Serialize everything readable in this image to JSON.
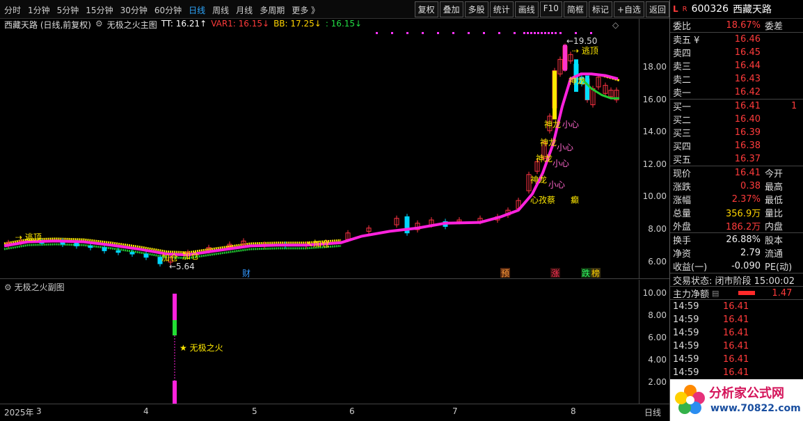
{
  "toolbar": {
    "periods": [
      "分时",
      "1分钟",
      "5分钟",
      "15分钟",
      "30分钟",
      "60分钟",
      "日线",
      "周线",
      "月线",
      "多周期",
      "更多 》"
    ],
    "active_period": "日线",
    "actions": [
      "复权",
      "叠加",
      "多股",
      "统计",
      "画线",
      "F10",
      "简框",
      "标记",
      "+自选",
      "返回"
    ]
  },
  "main_header": {
    "stock": "西藏天路 (日线,前复权)",
    "indicator": "无极之火主图",
    "tt": "TT: 16.21↑",
    "var1": "VAR1: 16.15↓",
    "bb": "BB: 17.25↓",
    "last": ": 16.15↓"
  },
  "chart_labels": {
    "escape_top_left": "逃顶",
    "escape_top_right": "逃顶",
    "jiacang_1": "加仓",
    "jiacang_2": "加仓",
    "jiacang_3": "加仓",
    "low_mark": "←5.64",
    "high_mark": "←19.50",
    "shenlong": "神龙",
    "xiaoxin": "小心",
    "zhiaoqi": "心孜蔡",
    "dian": "癫",
    "cai": "财",
    "yu": "预",
    "zhang": "涨",
    "die": "跌",
    "bang": "榜",
    "sub_title": "无极之火副图",
    "sub_legend": "★ 无极之火"
  },
  "main_axis": [
    "18.00",
    "16.00",
    "14.00",
    "12.00",
    "10.00",
    "8.00",
    "6.00"
  ],
  "sub_axis": [
    "10.00",
    "8.00",
    "6.00",
    "4.00",
    "2.00"
  ],
  "date_axis": [
    "2025年",
    "3",
    "4",
    "5",
    "6",
    "7",
    "8",
    "日线"
  ],
  "quote": {
    "code": "600326",
    "name": "西藏天路",
    "weibi_label": "委比",
    "weibi": "18.67%",
    "weicha_label": "委差",
    "asks": [
      {
        "label": "卖五 ¥",
        "price": "16.46"
      },
      {
        "label": "卖四",
        "price": "16.45"
      },
      {
        "label": "卖三",
        "price": "16.44"
      },
      {
        "label": "卖二",
        "price": "16.43"
      },
      {
        "label": "卖一",
        "price": "16.42"
      }
    ],
    "bids": [
      {
        "label": "买一",
        "price": "16.41",
        "vol": "1"
      },
      {
        "label": "买二",
        "price": "16.40",
        "vol": ""
      },
      {
        "label": "买三",
        "price": "16.39",
        "vol": ""
      },
      {
        "label": "买四",
        "price": "16.38",
        "vol": ""
      },
      {
        "label": "买五",
        "price": "16.37",
        "vol": ""
      }
    ],
    "stats1": [
      {
        "k": "现价",
        "v": "16.41",
        "k2": "今开",
        "cls": "red"
      },
      {
        "k": "涨跌",
        "v": "0.38",
        "k2": "最高",
        "cls": "red"
      },
      {
        "k": "涨幅",
        "v": "2.37%",
        "k2": "最低",
        "cls": "red"
      },
      {
        "k": "总量",
        "v": "356.9万",
        "k2": "量比",
        "cls": "yellow"
      },
      {
        "k": "外盘",
        "v": "186.2万",
        "k2": "内盘",
        "cls": "red"
      }
    ],
    "stats2": [
      {
        "k": "换手",
        "v": "26.88%",
        "k2": "股本"
      },
      {
        "k": "净资",
        "v": "2.79",
        "k2": "流通"
      },
      {
        "k": "收益(一)",
        "v": "-0.090",
        "k2": "PE(动)"
      }
    ],
    "trade_state": "交易状态: 闭市阶段 15:00:02",
    "main_net_label": "主力净额",
    "main_net_value": "1.47",
    "ticks": [
      {
        "t": "14:59",
        "p": "16.41"
      },
      {
        "t": "14:59",
        "p": "16.41"
      },
      {
        "t": "14:59",
        "p": "16.41"
      },
      {
        "t": "14:59",
        "p": "16.41"
      },
      {
        "t": "14:59",
        "p": "16.41"
      },
      {
        "t": "14:59",
        "p": "16.41"
      }
    ]
  },
  "watermark": {
    "title": "分析家公式网",
    "url": "www.70822.com"
  }
}
